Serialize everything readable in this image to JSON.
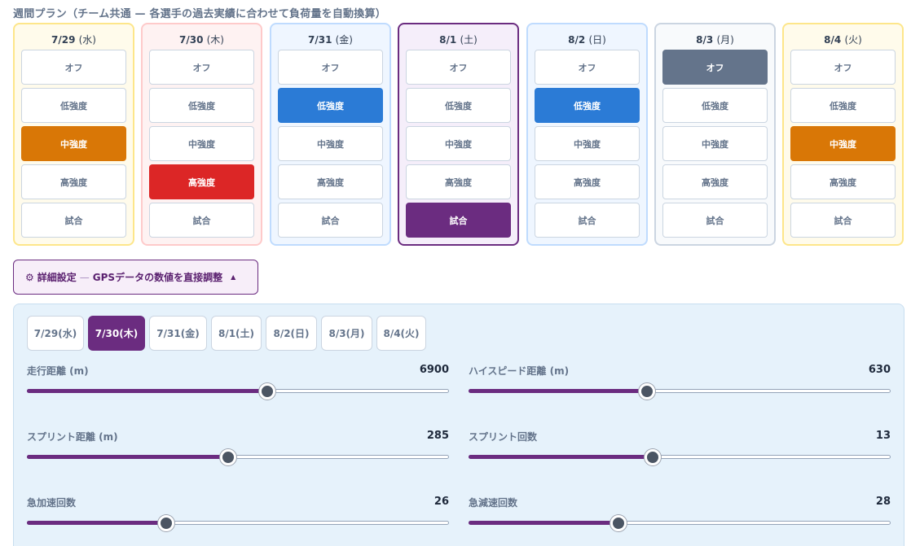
{
  "section_title": "週間プラン（チーム共通 — 各選手の過去実績に合わせて負荷量を自動換算）",
  "colors": {
    "accent": "#6b2c80",
    "low": "#2b7bd6",
    "mid": "#d97706",
    "high": "#dc2626",
    "off": "#64748b",
    "match": "#6b2c80"
  },
  "days": [
    {
      "date": "7/29",
      "weekday": "(水)",
      "border": "#fde68a",
      "bg": "#fffbeb",
      "options": [
        "オフ",
        "低強度",
        "中強度",
        "高強度",
        "試合"
      ],
      "selected": 2,
      "selected_color": "#d97706"
    },
    {
      "date": "7/30",
      "weekday": "(木)",
      "border": "#fecaca",
      "bg": "#fef2f2",
      "options": [
        "オフ",
        "低強度",
        "中強度",
        "高強度",
        "試合"
      ],
      "selected": 3,
      "selected_color": "#dc2626"
    },
    {
      "date": "7/31",
      "weekday": "(金)",
      "border": "#bfdbfe",
      "bg": "#eff6ff",
      "options": [
        "オフ",
        "低強度",
        "中強度",
        "高強度",
        "試合"
      ],
      "selected": 1,
      "selected_color": "#2b7bd6"
    },
    {
      "date": "8/1",
      "weekday": "(土)",
      "border": "#6b2c80",
      "bg": "#f5eefa",
      "options": [
        "オフ",
        "低強度",
        "中強度",
        "高強度",
        "試合"
      ],
      "selected": 4,
      "selected_color": "#6b2c80"
    },
    {
      "date": "8/2",
      "weekday": "(日)",
      "border": "#bfdbfe",
      "bg": "#eff6ff",
      "options": [
        "オフ",
        "低強度",
        "中強度",
        "高強度",
        "試合"
      ],
      "selected": 1,
      "selected_color": "#2b7bd6"
    },
    {
      "date": "8/3",
      "weekday": "(月)",
      "border": "#cbd5e1",
      "bg": "#f8fafc",
      "options": [
        "オフ",
        "低強度",
        "中強度",
        "高強度",
        "試合"
      ],
      "selected": 0,
      "selected_color": "#64748b"
    },
    {
      "date": "8/4",
      "weekday": "(火)",
      "border": "#fde68a",
      "bg": "#fffbeb",
      "options": [
        "オフ",
        "低強度",
        "中強度",
        "高強度",
        "試合"
      ],
      "selected": 2,
      "selected_color": "#d97706"
    }
  ],
  "settings": {
    "gear_glyph": "⚙",
    "label": "詳細設定",
    "dash": "—",
    "description": "GPSデータの数値を直接調整",
    "caret": "▲",
    "tabs": [
      "7/29(水)",
      "7/30(木)",
      "7/31(金)",
      "8/1(土)",
      "8/2(日)",
      "8/3(月)",
      "8/4(火)"
    ],
    "active_tab": 1,
    "sliders": [
      {
        "label": "走行距離 (m)",
        "value": "6900",
        "level": 0.57
      },
      {
        "label": "ハイスピード距離 (m)",
        "value": "630",
        "level": 0.423
      },
      {
        "label": "スプリント距離 (m)",
        "value": "285",
        "level": 0.477
      },
      {
        "label": "スプリント回数",
        "value": "13",
        "level": 0.437
      },
      {
        "label": "急加速回数",
        "value": "26",
        "level": 0.33
      },
      {
        "label": "急減速回数",
        "value": "28",
        "level": 0.355
      }
    ]
  }
}
